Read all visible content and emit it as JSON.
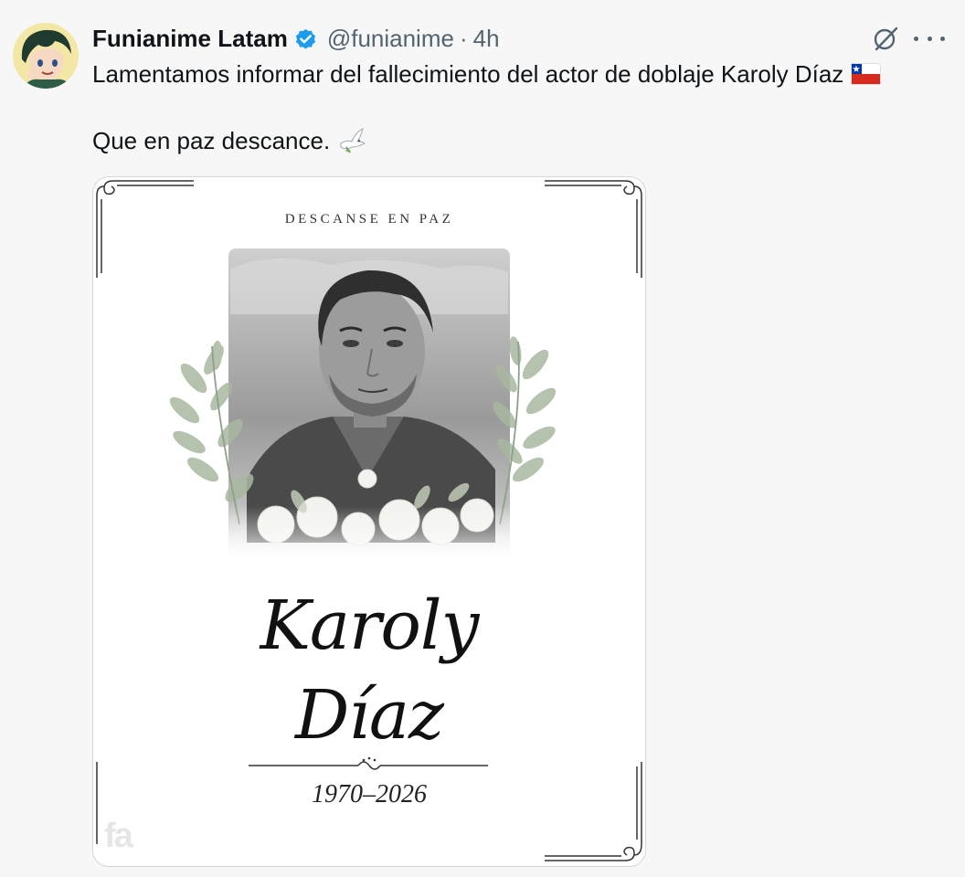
{
  "tweet": {
    "author": {
      "display_name": "Funianime Latam",
      "handle": "@funianime",
      "verified": true,
      "verified_color": "#1d9bf0"
    },
    "separator": "·",
    "timestamp": "4h",
    "text_line1": "Lamentamos informar del fallecimiento del actor de doblaje Karoly Díaz",
    "text_line2": "Que en paz descance.",
    "emoji": {
      "flag": "chile-flag",
      "dove": "dove-of-peace"
    },
    "actions": {
      "grok": "grok-icon",
      "more": "more-icon"
    }
  },
  "media": {
    "header_text": "DESCANSE EN PAZ",
    "first_name": "Karoly",
    "last_name": "Díaz",
    "years": "1970–2026",
    "watermark": "fa"
  },
  "colors": {
    "text_primary": "#0f1419",
    "text_secondary": "#536471",
    "background": "#f7f7f7",
    "card_border": "#cfd9de"
  }
}
